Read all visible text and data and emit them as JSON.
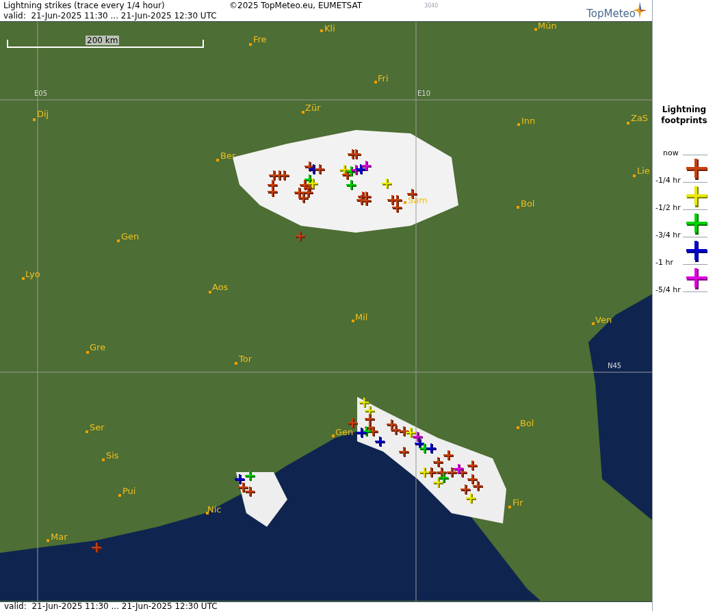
{
  "header": {
    "title": "Lightning strikes (trace every 1/4 hour)",
    "copyright": "©2025 TopMeteo.eu, EUMETSAT",
    "code": "3040",
    "valid": "valid:  21-Jun-2025 11:30 ... 21-Jun-2025 12:30 UTC",
    "logo": "TopMeteo"
  },
  "map": {
    "scale_label": "200 km",
    "grid_labels": [
      "E05",
      "E10",
      "N45"
    ],
    "places": [
      {
        "label": "Fre"
      },
      {
        "label": "Kli"
      },
      {
        "label": "Mün"
      },
      {
        "label": "Fri"
      },
      {
        "label": "Dij"
      },
      {
        "label": "Zür"
      },
      {
        "label": "Inn"
      },
      {
        "label": "ZaS"
      },
      {
        "label": "Ber"
      },
      {
        "label": "Lie"
      },
      {
        "label": "Bol"
      },
      {
        "label": "Sam"
      },
      {
        "label": "Gen"
      },
      {
        "label": "Lyo"
      },
      {
        "label": "Aos"
      },
      {
        "label": "Mil"
      },
      {
        "label": "Ven"
      },
      {
        "label": "Gre"
      },
      {
        "label": "Tor"
      },
      {
        "label": "Ser"
      },
      {
        "label": "Gen"
      },
      {
        "label": "Bol"
      },
      {
        "label": "Sis"
      },
      {
        "label": "Pui"
      },
      {
        "label": "Nic"
      },
      {
        "label": "Fir"
      },
      {
        "label": "Mar"
      }
    ],
    "strikes": [
      {
        "color": "#c84010"
      },
      {
        "color": "#c84010"
      },
      {
        "color": "#c84010"
      },
      {
        "color": "#c84010"
      },
      {
        "color": "#c84010"
      },
      {
        "color": "#c84010"
      },
      {
        "color": "#c84010"
      },
      {
        "color": "#c84010"
      },
      {
        "color": "#c84010"
      },
      {
        "color": "#c84010"
      },
      {
        "color": "#00d000"
      },
      {
        "color": "#e8e800"
      },
      {
        "color": "#c84010"
      },
      {
        "color": "#0000d0"
      },
      {
        "color": "#c84010"
      },
      {
        "color": "#c84010"
      },
      {
        "color": "#c84010"
      },
      {
        "color": "#e8e800"
      },
      {
        "color": "#c84010"
      },
      {
        "color": "#00d000"
      },
      {
        "color": "#00d000"
      },
      {
        "color": "#e000e0"
      },
      {
        "color": "#0000d0"
      },
      {
        "color": "#e000e0"
      },
      {
        "color": "#c84010"
      },
      {
        "color": "#c84010"
      },
      {
        "color": "#c84010"
      },
      {
        "color": "#c84010"
      },
      {
        "color": "#e8e800"
      },
      {
        "color": "#c84010"
      },
      {
        "color": "#c84010"
      },
      {
        "color": "#c84010"
      },
      {
        "color": "#c84010"
      },
      {
        "color": "#c84010"
      },
      {
        "color": "#e8e800"
      },
      {
        "color": "#e8e800"
      },
      {
        "color": "#c84010"
      },
      {
        "color": "#c84010"
      },
      {
        "color": "#c84010"
      },
      {
        "color": "#c84010"
      },
      {
        "color": "#00d000"
      },
      {
        "color": "#0000d0"
      },
      {
        "color": "#c84010"
      },
      {
        "color": "#c84010"
      },
      {
        "color": "#c84010"
      },
      {
        "color": "#0000d0"
      },
      {
        "color": "#e8e800"
      },
      {
        "color": "#e000e0"
      },
      {
        "color": "#0000d0"
      },
      {
        "color": "#00d000"
      },
      {
        "color": "#0000d0"
      },
      {
        "color": "#c84010"
      },
      {
        "color": "#c84010"
      },
      {
        "color": "#c84010"
      },
      {
        "color": "#c84010"
      },
      {
        "color": "#c84010"
      },
      {
        "color": "#c84010"
      },
      {
        "color": "#c84010"
      },
      {
        "color": "#c84010"
      },
      {
        "color": "#c84010"
      },
      {
        "color": "#c84010"
      },
      {
        "color": "#e8e800"
      },
      {
        "color": "#e8e800"
      },
      {
        "color": "#e000e0"
      },
      {
        "color": "#00d000"
      },
      {
        "color": "#e8e800"
      },
      {
        "color": "#c84010"
      },
      {
        "color": "#00d000"
      },
      {
        "color": "#0000d0"
      },
      {
        "color": "#c84010"
      },
      {
        "color": "#c84010"
      },
      {
        "color": "#c84010"
      }
    ]
  },
  "legend": {
    "title": "Lightning footprints",
    "marks": [
      "now",
      "-1/4 hr",
      "-1/2 hr",
      "-3/4 hr",
      "-1 hr",
      "-5/4 hr"
    ],
    "colors": [
      {
        "color": "#c84010"
      },
      {
        "color": "#e8e800"
      },
      {
        "color": "#00d000"
      },
      {
        "color": "#0000d0"
      },
      {
        "color": "#e000e0"
      }
    ]
  },
  "footer": {
    "valid": "valid:  21-Jun-2025 11:30 ... 21-Jun-2025 12:30 UTC"
  }
}
